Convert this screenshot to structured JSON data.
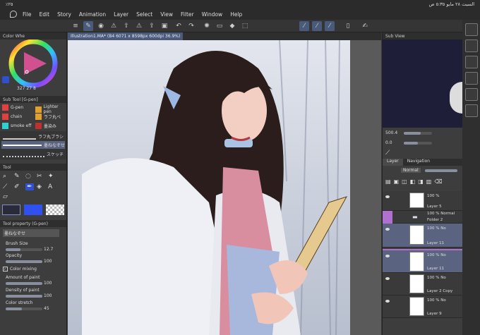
{
  "status": {
    "time": "٥:٣٥ ص",
    "date": "السبت ٢٨ مايو",
    "battery": "٪٢٥"
  },
  "menu": [
    "File",
    "Edit",
    "Story",
    "Animation",
    "Layer",
    "Select",
    "View",
    "Filter",
    "Window",
    "Help"
  ],
  "canvas_tab": "Illustration1.MA* (B4 6071 x 8598px 600dpi 36.9%)",
  "color_wheel": {
    "title": "Color Whe",
    "hue": "327",
    "sat": "27",
    "val": "8"
  },
  "sub_tool": {
    "title": "Sub Tool [G-pen]",
    "items": [
      {
        "label": "G-pen"
      },
      {
        "label": "Lighter pen"
      },
      {
        "label": "chain"
      },
      {
        "label": "ラフ丸ぺ"
      },
      {
        "label": "smoke eff"
      },
      {
        "label": "墨染み"
      }
    ],
    "brushes": [
      "ラフ丸ブラシ",
      "墨ねなぞせ",
      "スケッチ"
    ]
  },
  "tool": {
    "title": "Tool"
  },
  "tool_property": {
    "title": "Tool property (G-pen)",
    "name": "墨ねなぞせ",
    "brush_size_label": "Brush Size",
    "brush_size": "12.7",
    "opacity_label": "Opacity",
    "opacity": "100",
    "color_mixing_label": "Color mixing",
    "amount_label": "Amount of paint",
    "amount": "100",
    "density_label": "Density of paint",
    "density": "100",
    "stretch_label": "Color stretch",
    "stretch": "45"
  },
  "sub_view": {
    "title": "Sub View",
    "zoom": "500.4",
    "angle": "0.0"
  },
  "layer_panel": {
    "tabs": [
      "Layer",
      "Navigation"
    ],
    "blend": "Normal",
    "layers": [
      {
        "pct": "100 %",
        "blend": "",
        "name": "Layer 5"
      },
      {
        "pct": "100 %",
        "blend": "Normal",
        "name": "Folder 2"
      },
      {
        "pct": "100 %",
        "blend": "No",
        "name": "Layer 11"
      },
      {
        "pct": "100 %",
        "blend": "No",
        "name": "Layer 11"
      },
      {
        "pct": "100 %",
        "blend": "No",
        "name": "Layer 2 Copy"
      },
      {
        "pct": "100 %",
        "blend": "No",
        "name": "Layer 9"
      }
    ]
  }
}
